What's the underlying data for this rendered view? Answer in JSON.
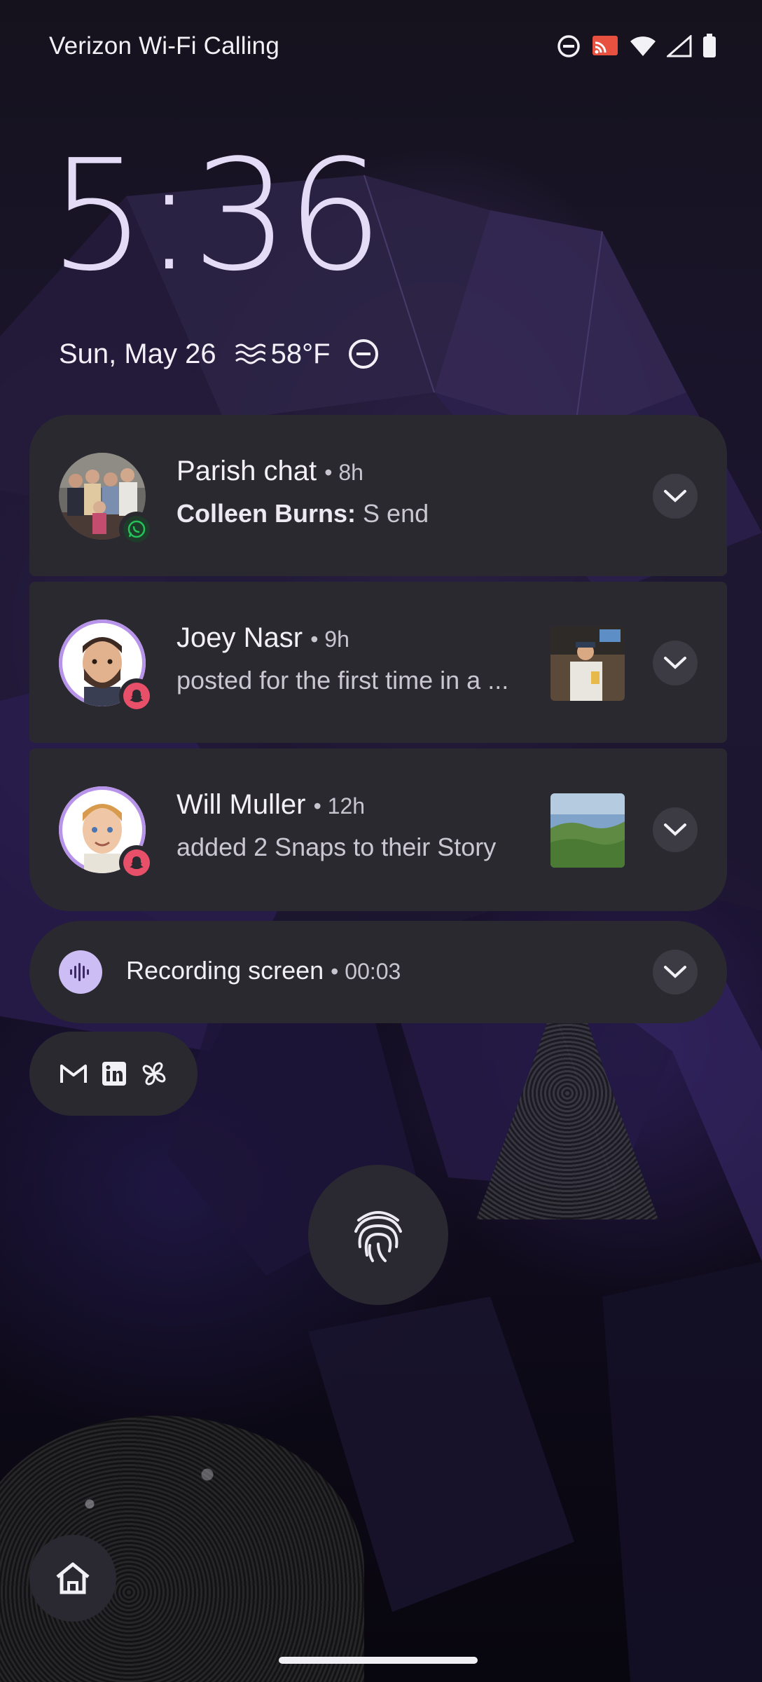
{
  "status_bar": {
    "carrier": "Verizon Wi-Fi Calling",
    "icons": [
      "dnd-icon",
      "cast-icon",
      "wifi-icon",
      "signal-icon",
      "battery-icon"
    ]
  },
  "lockscreen": {
    "time": "5:36",
    "date": "Sun, May 26",
    "weather_icon": "haze-icon",
    "temperature": "58°F",
    "dnd_icon": "dnd-icon"
  },
  "notifications": [
    {
      "title": "Parish chat",
      "time": "• 8h",
      "sender": "Colleen Burns:",
      "message": "S end",
      "app_icon": "whatsapp-icon",
      "avatar": "group-photo-avatar"
    },
    {
      "title": "Joey Nasr",
      "time": "• 9h",
      "message": "posted for the first time in a ...",
      "app_icon": "snapchat-icon",
      "avatar": "bitmoji-avatar"
    },
    {
      "title": "Will Muller",
      "time": "• 12h",
      "message": "added 2 Snaps to their Story",
      "app_icon": "snapchat-icon",
      "avatar": "bitmoji-avatar"
    }
  ],
  "recording": {
    "label": "Recording screen",
    "time": "• 00:03",
    "icon": "audio-wave-icon"
  },
  "more_apps": [
    "gmail-icon",
    "linkedin-icon",
    "pinwheel-icon"
  ],
  "colors": {
    "card_bg": "#2b2930",
    "clock_color": "#e4dcf7",
    "accent": "#cdbdf5",
    "avatar_ring": "#b794e9",
    "snapchat_badge": "#e8506a",
    "whatsapp_badge": "#25a244"
  }
}
